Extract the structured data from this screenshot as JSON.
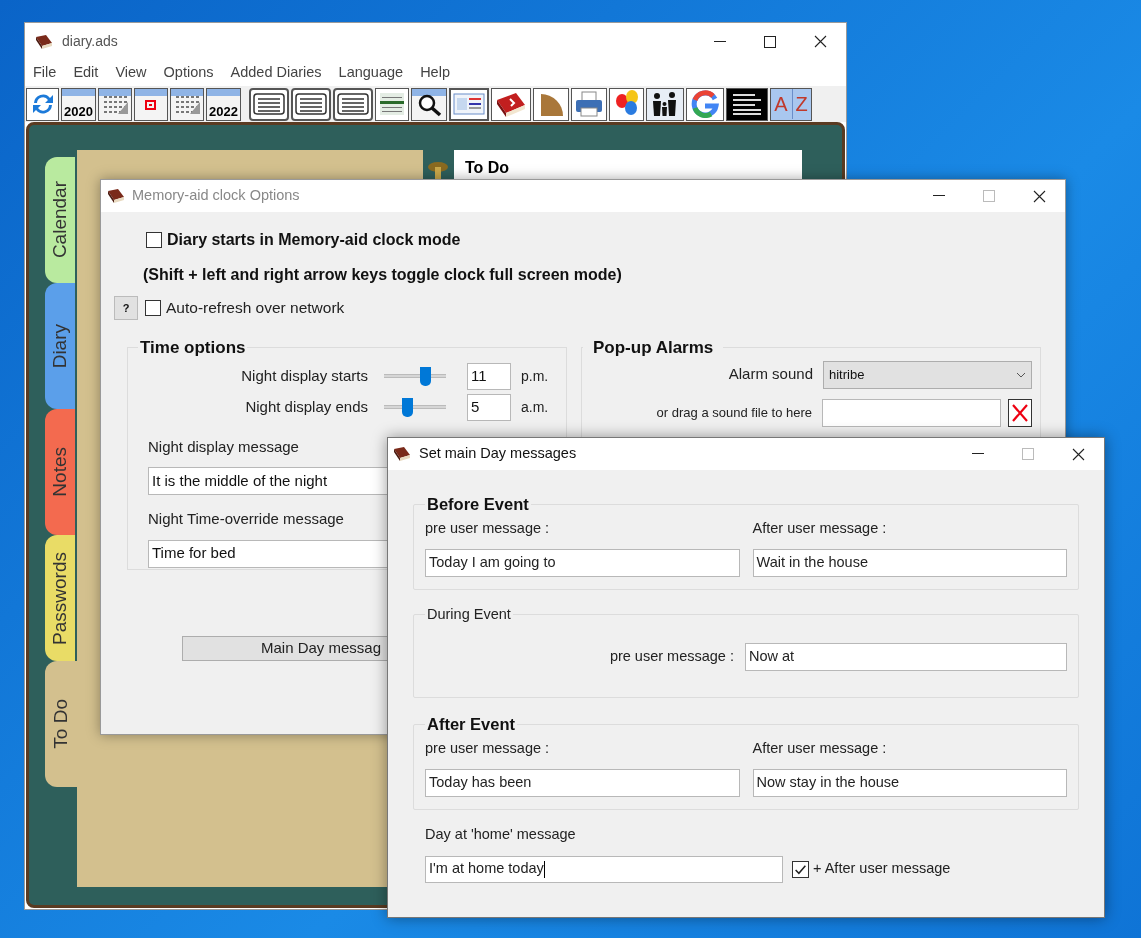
{
  "main_window": {
    "title": "diary.ads",
    "menu": [
      "File",
      "Edit",
      "View",
      "Options",
      "Added Diaries",
      "Language",
      "Help"
    ],
    "toolbar_years": [
      "2020",
      "2022"
    ],
    "toolbar_letters": [
      "A",
      "Z"
    ],
    "side_tabs": [
      {
        "label": "Calendar",
        "color": "#b9ea9f",
        "selected": false
      },
      {
        "label": "Diary",
        "color": "#5b9fea",
        "selected": false
      },
      {
        "label": "Notes",
        "color": "#f36a4f",
        "selected": false
      },
      {
        "label": "Passwords",
        "color": "#e9dc66",
        "selected": false
      },
      {
        "label": "To Do",
        "color": "#d3c08e",
        "selected": true
      }
    ],
    "page_heading": "To Do"
  },
  "clock_options": {
    "title": "Memory-aid clock Options",
    "start_in_clock_mode": {
      "label": "Diary starts in Memory-aid clock mode",
      "checked": false
    },
    "shortcut_note": "(Shift + left and right arrow keys toggle clock full screen mode)",
    "help_button": "?",
    "auto_refresh": {
      "label": "Auto-refresh over network",
      "checked": false
    },
    "time_options": {
      "title": "Time options",
      "rows": [
        {
          "label": "Night display starts",
          "level": 0.66,
          "value": "11",
          "unit": "p.m."
        },
        {
          "label": "Night display ends",
          "level": 0.37,
          "value": "5",
          "unit": "a.m."
        }
      ],
      "fields": [
        {
          "label": "Night display message",
          "value": "It is the middle of the night"
        },
        {
          "label": "Night Time-override message",
          "value": "Time for bed"
        }
      ]
    },
    "popup_alarms": {
      "title": "Pop-up Alarms",
      "alarm_sound": {
        "label": "Alarm sound",
        "value": "hitribe"
      },
      "sound_file": {
        "label": "or drag a sound file to here"
      }
    },
    "main_day_button": "Main Day messag"
  },
  "day_messages": {
    "title": "Set main Day messages",
    "before_event": {
      "title": "Before Event",
      "pre_label": "pre user message :",
      "pre_value": "Today I am going to",
      "after_label": "After user message :",
      "after_value": "Wait in the house"
    },
    "during_event": {
      "title": "During Event",
      "pre_label": "pre user message :",
      "pre_value": "Now at"
    },
    "after_event": {
      "title": "After Event",
      "pre_label": "pre user message :",
      "pre_value": "Today has been",
      "after_label": "After user message :",
      "after_value": "Now stay in the house"
    },
    "home": {
      "label": "Day at 'home' message",
      "value": "I'm at home today",
      "append": {
        "label": "+ After user message",
        "checked": true
      }
    }
  }
}
